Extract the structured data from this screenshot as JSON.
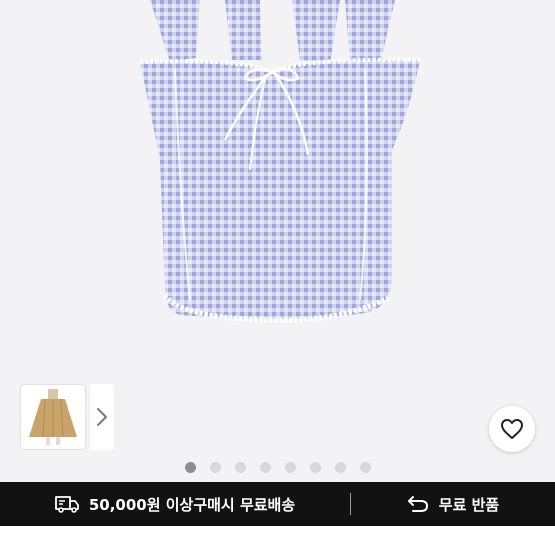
{
  "gallery": {
    "image_name": "gingham-halter-crop-top",
    "thumbnail_name": "beige-maxi-skirt-thumbnail",
    "dots_total": 8,
    "dots_active_index": 0
  },
  "icons": {
    "next": "chevron-right-icon",
    "wishlist": "heart-icon",
    "shipping": "truck-icon",
    "returns": "return-arrow-icon"
  },
  "promo": {
    "shipping_text": "50,000원 이상구매시 무료배송",
    "returns_text": "무료 반품"
  },
  "colors": {
    "promo_background": "#121212",
    "gingham_lavender": "#b8bfe6",
    "dot_active": "#8e8e8e",
    "dot_inactive": "#d8d8d8"
  }
}
